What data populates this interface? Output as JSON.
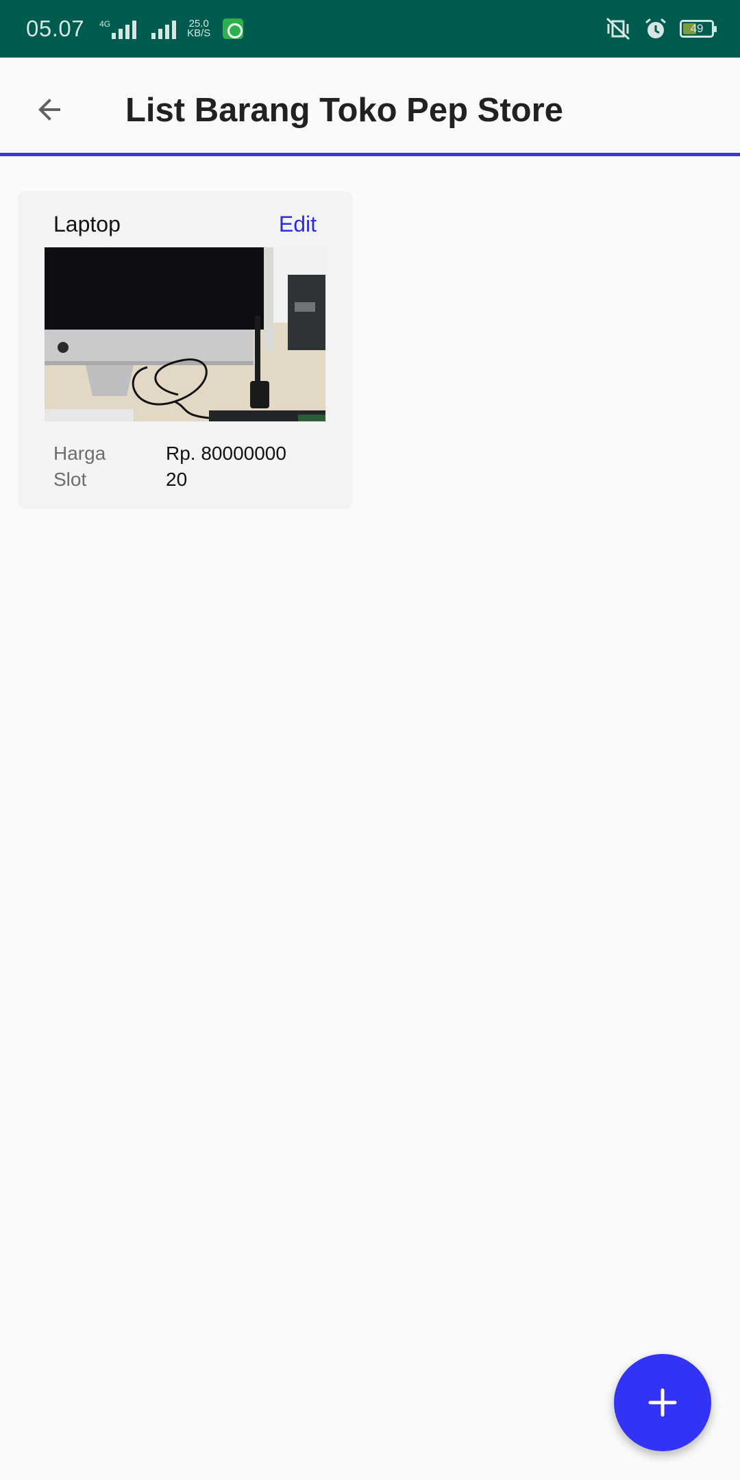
{
  "status_bar": {
    "time": "05.07",
    "network_type": "4G",
    "net_speed_value": "25.0",
    "net_speed_unit": "KB/S",
    "battery_level": "49",
    "icons": [
      "signal-icon",
      "signal-icon",
      "whatsapp-icon",
      "vibrate-icon",
      "alarm-icon",
      "battery-icon"
    ],
    "background_color": "#005b4f"
  },
  "app_bar": {
    "title": "List Barang Toko Pep Store",
    "back_icon": "arrow-back-icon",
    "accent_color": "#3a3ad9"
  },
  "products": [
    {
      "name": "Laptop",
      "edit_label": "Edit",
      "price_label": "Harga",
      "price_value": "Rp. 80000000",
      "slot_label": "Slot",
      "slot_value": "20"
    }
  ],
  "fab": {
    "icon": "plus-icon",
    "color": "#3333f5"
  }
}
